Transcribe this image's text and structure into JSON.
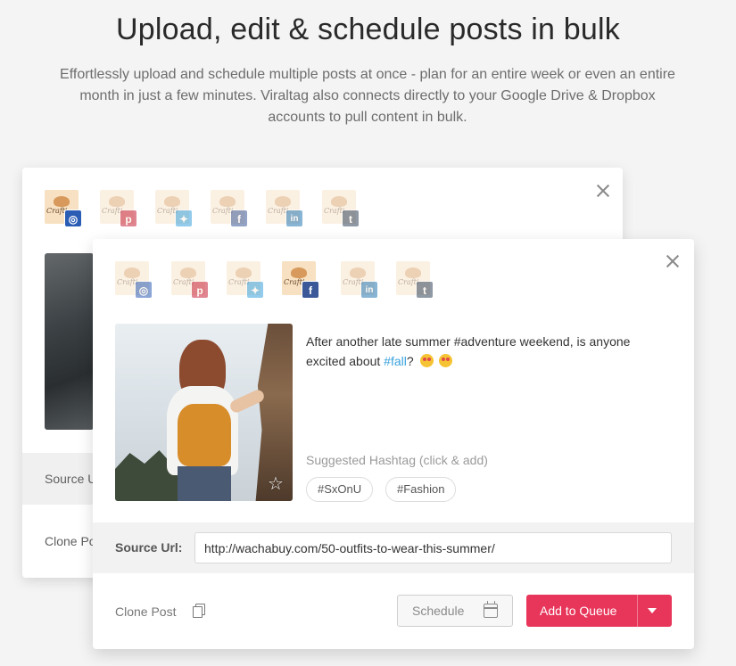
{
  "hero": {
    "title": "Upload, edit & schedule posts in bulk",
    "description": "Effortlessly upload and schedule multiple posts at once - plan for an entire week or even an entire month in just a few minutes. Viraltag also connects directly to your Google Drive & Dropbox accounts to pull content in bulk."
  },
  "account_brand": "Crafti",
  "back_card": {
    "source_label": "Source U",
    "clone_label": "Clone Po",
    "accounts": [
      {
        "network": "instagram",
        "badge": "◎",
        "active": true
      },
      {
        "network": "pinterest",
        "badge": "p",
        "active": false
      },
      {
        "network": "twitter",
        "badge": "✦",
        "active": false
      },
      {
        "network": "facebook",
        "badge": "f",
        "active": false
      },
      {
        "network": "linkedin",
        "badge": "in",
        "active": false
      },
      {
        "network": "tumblr",
        "badge": "t",
        "active": false
      }
    ]
  },
  "front_card": {
    "accounts": [
      {
        "network": "instagram",
        "badge": "◎",
        "active": false
      },
      {
        "network": "pinterest",
        "badge": "p",
        "active": false
      },
      {
        "network": "twitter",
        "badge": "✦",
        "active": false
      },
      {
        "network": "facebook",
        "badge": "f",
        "active": true
      },
      {
        "network": "linkedin",
        "badge": "in",
        "active": false
      },
      {
        "network": "tumblr",
        "badge": "t",
        "active": false
      }
    ],
    "caption_before": "After another late summer #adventure weekend, is anyone excited about ",
    "caption_tag": "#fall",
    "caption_after": "?",
    "emoji": [
      "heart-eyes",
      "heart-eyes"
    ],
    "suggested_label": "Suggested Hashtag (click & add)",
    "suggested_tags": [
      "#SxOnU",
      "#Fashion"
    ],
    "source_label": "Source Url:",
    "source_value": "http://wachabuy.com/50-outfits-to-wear-this-summer/",
    "clone_label": "Clone Post",
    "schedule_label": "Schedule",
    "queue_label": "Add to Queue"
  },
  "colors": {
    "accent": "#e8365a",
    "link": "#3aa2dd",
    "background": "#f4f4f4"
  }
}
